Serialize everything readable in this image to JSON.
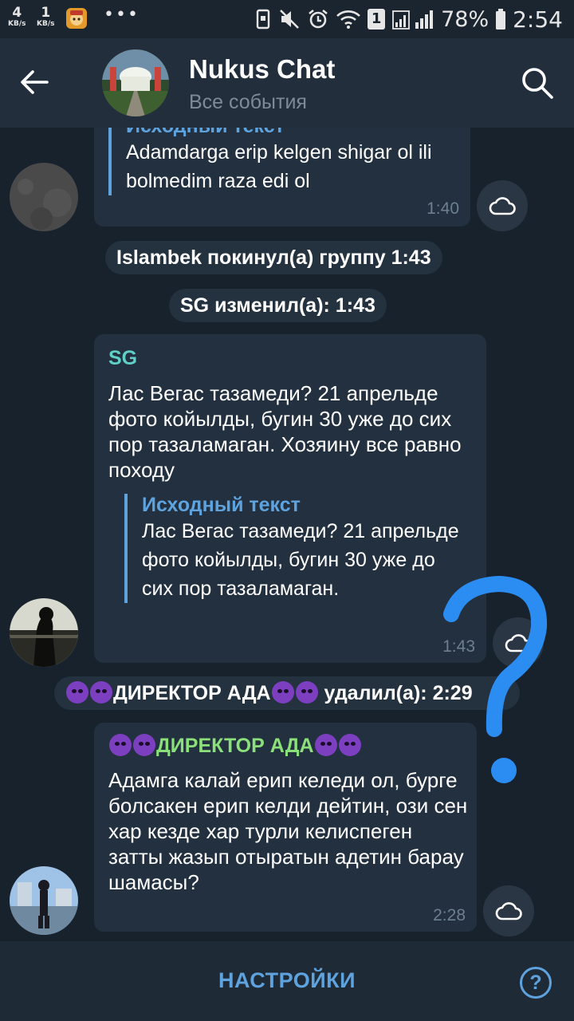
{
  "status_bar": {
    "speed_down_value": "4",
    "speed_down_unit": "KB/s",
    "speed_up_value": "1",
    "speed_up_unit": "KB/s",
    "more_dots": "•••",
    "sim_badge": "1",
    "battery": "78%",
    "time": "2:54"
  },
  "header": {
    "title": "Nukus Chat",
    "subtitle": "Все события"
  },
  "messages": {
    "msg1": {
      "quote_title": "Исходный текст",
      "quote_text": "Adamdarga erip kelgen shigar ol ili bolmedim raza edi ol",
      "time": "1:40"
    },
    "service1": "Islambek покинул(а) группу  1:43",
    "service2": "SG изменил(а):  1:43",
    "msg2": {
      "author": "SG",
      "text": "Лас Вегас тазамеди? 21 апрельде фото койылды, бугин 30 уже до сих пор тазаламаган. Хозяину все равно походу",
      "quote_title": "Исходный текст",
      "quote_text": "Лас Вегас тазамеди? 21 апрельде фото койылды, бугин 30 уже до сих пор тазаламаган.",
      "time": "1:43"
    },
    "service3": {
      "name": "ДИРЕКТОР АДА",
      "action": "удалил(а):",
      "time": "2:29"
    },
    "msg3": {
      "author": "ДИРЕКТОР АДА",
      "text": "Адамга калай ерип келеди ол, бурге болсакен ерип келди дейтин, ози сен хар кезде хар турли келиспеген затты жазып отыратын адетин барау шамасы?",
      "time": "2:28"
    }
  },
  "bottom": {
    "settings_label": "НАСТРОЙКИ",
    "help_label": "?"
  },
  "colors": {
    "background": "#18222d",
    "toolbar": "#232e3c",
    "bubble": "#22303f",
    "accent": "#5fa3de",
    "author_sg": "#5fcfc8",
    "author_director": "#8be07a",
    "overlay_question": "#2b8df2"
  }
}
